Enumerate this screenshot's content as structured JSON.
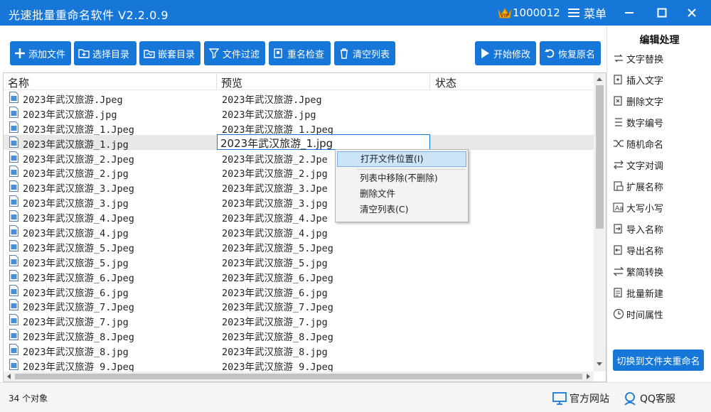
{
  "window": {
    "title": "光速批量重命名软件 V2.2.0.9",
    "user_id": "1000012",
    "menu_label": "菜单",
    "icons": [
      "vip-icon",
      "menu-icon",
      "minimize-icon",
      "maximize-icon",
      "close-icon"
    ]
  },
  "toolbar": {
    "add_files": "添加文件",
    "select_dir": "选择目录",
    "nested_dir": "嵌套目录",
    "file_filter": "文件过滤",
    "rename_check": "重名检查",
    "clear_list": "清空列表",
    "start_modify": "开始修改",
    "restore_name": "恢复原名"
  },
  "list": {
    "columns": {
      "name": "名称",
      "preview": "预览",
      "status": "状态"
    },
    "selected_index": 3,
    "editing_value": "2023年武汉旅游_1.jpg",
    "rows": [
      {
        "name": "2023年武汉旅游.Jpeg",
        "preview": "2023年武汉旅游.Jpeg"
      },
      {
        "name": "2023年武汉旅游.jpg",
        "preview": "2023年武汉旅游.jpg"
      },
      {
        "name": "2023年武汉旅游_1.Jpeg",
        "preview": "2023年武汉旅游_1.Jpeg"
      },
      {
        "name": "2023年武汉旅游_1.jpg",
        "preview": ""
      },
      {
        "name": "2023年武汉旅游_2.Jpeg",
        "preview": "2023年武汉旅游_2.Jpe"
      },
      {
        "name": "2023年武汉旅游_2.jpg",
        "preview": "2023年武汉旅游_2.jpg"
      },
      {
        "name": "2023年武汉旅游_3.Jpeg",
        "preview": "2023年武汉旅游_3.Jpe"
      },
      {
        "name": "2023年武汉旅游_3.jpg",
        "preview": "2023年武汉旅游_3.jpg"
      },
      {
        "name": "2023年武汉旅游_4.Jpeg",
        "preview": "2023年武汉旅游_4.Jpe"
      },
      {
        "name": "2023年武汉旅游_4.jpg",
        "preview": "2023年武汉旅游_4.jpg"
      },
      {
        "name": "2023年武汉旅游_5.Jpeg",
        "preview": "2023年武汉旅游_5.Jpeg"
      },
      {
        "name": "2023年武汉旅游_5.jpg",
        "preview": "2023年武汉旅游_5.jpg"
      },
      {
        "name": "2023年武汉旅游_6.Jpeg",
        "preview": "2023年武汉旅游_6.Jpeg"
      },
      {
        "name": "2023年武汉旅游_6.jpg",
        "preview": "2023年武汉旅游_6.jpg"
      },
      {
        "name": "2023年武汉旅游_7.Jpeg",
        "preview": "2023年武汉旅游_7.Jpeg"
      },
      {
        "name": "2023年武汉旅游_7.jpg",
        "preview": "2023年武汉旅游_7.jpg"
      },
      {
        "name": "2023年武汉旅游_8.Jpeg",
        "preview": "2023年武汉旅游_8.Jpeg"
      },
      {
        "name": "2023年武汉旅游_8.jpg",
        "preview": "2023年武汉旅游_8.jpg"
      },
      {
        "name": "2023年武汉旅游_9.Jpeg",
        "preview": "2023年武汉旅游_9.Jpeg"
      }
    ]
  },
  "context_menu": {
    "open_location": "打开文件位置(I)",
    "remove_from_list": "列表中移除(不删除)",
    "delete_file": "删除文件",
    "clear_list": "清空列表(C)"
  },
  "panel": {
    "title": "编辑处理",
    "items": [
      {
        "label": "文字替换",
        "icon": "replace-icon"
      },
      {
        "label": "插入文字",
        "icon": "insert-icon"
      },
      {
        "label": "删除文字",
        "icon": "delete-text-icon"
      },
      {
        "label": "数字编号",
        "icon": "numbering-icon"
      },
      {
        "label": "随机命名",
        "icon": "shuffle-icon"
      },
      {
        "label": "文字对调",
        "icon": "swap-icon"
      },
      {
        "label": "扩展名称",
        "icon": "extension-icon"
      },
      {
        "label": "大写小写",
        "icon": "case-icon"
      },
      {
        "label": "导入名称",
        "icon": "import-icon"
      },
      {
        "label": "导出名称",
        "icon": "export-icon"
      },
      {
        "label": "繁简转换",
        "icon": "convert-icon"
      },
      {
        "label": "批量新建",
        "icon": "batch-new-icon"
      },
      {
        "label": "时间属性",
        "icon": "clock-icon"
      }
    ],
    "switch_label": "切换到文件夹重命名"
  },
  "status": {
    "count": "34 个对象",
    "website": "官方网站",
    "qq": "QQ客服"
  },
  "colors": {
    "accent": "#1677d9",
    "selection": "#e8e8e8",
    "menu_highlight": "#cce4f7"
  }
}
